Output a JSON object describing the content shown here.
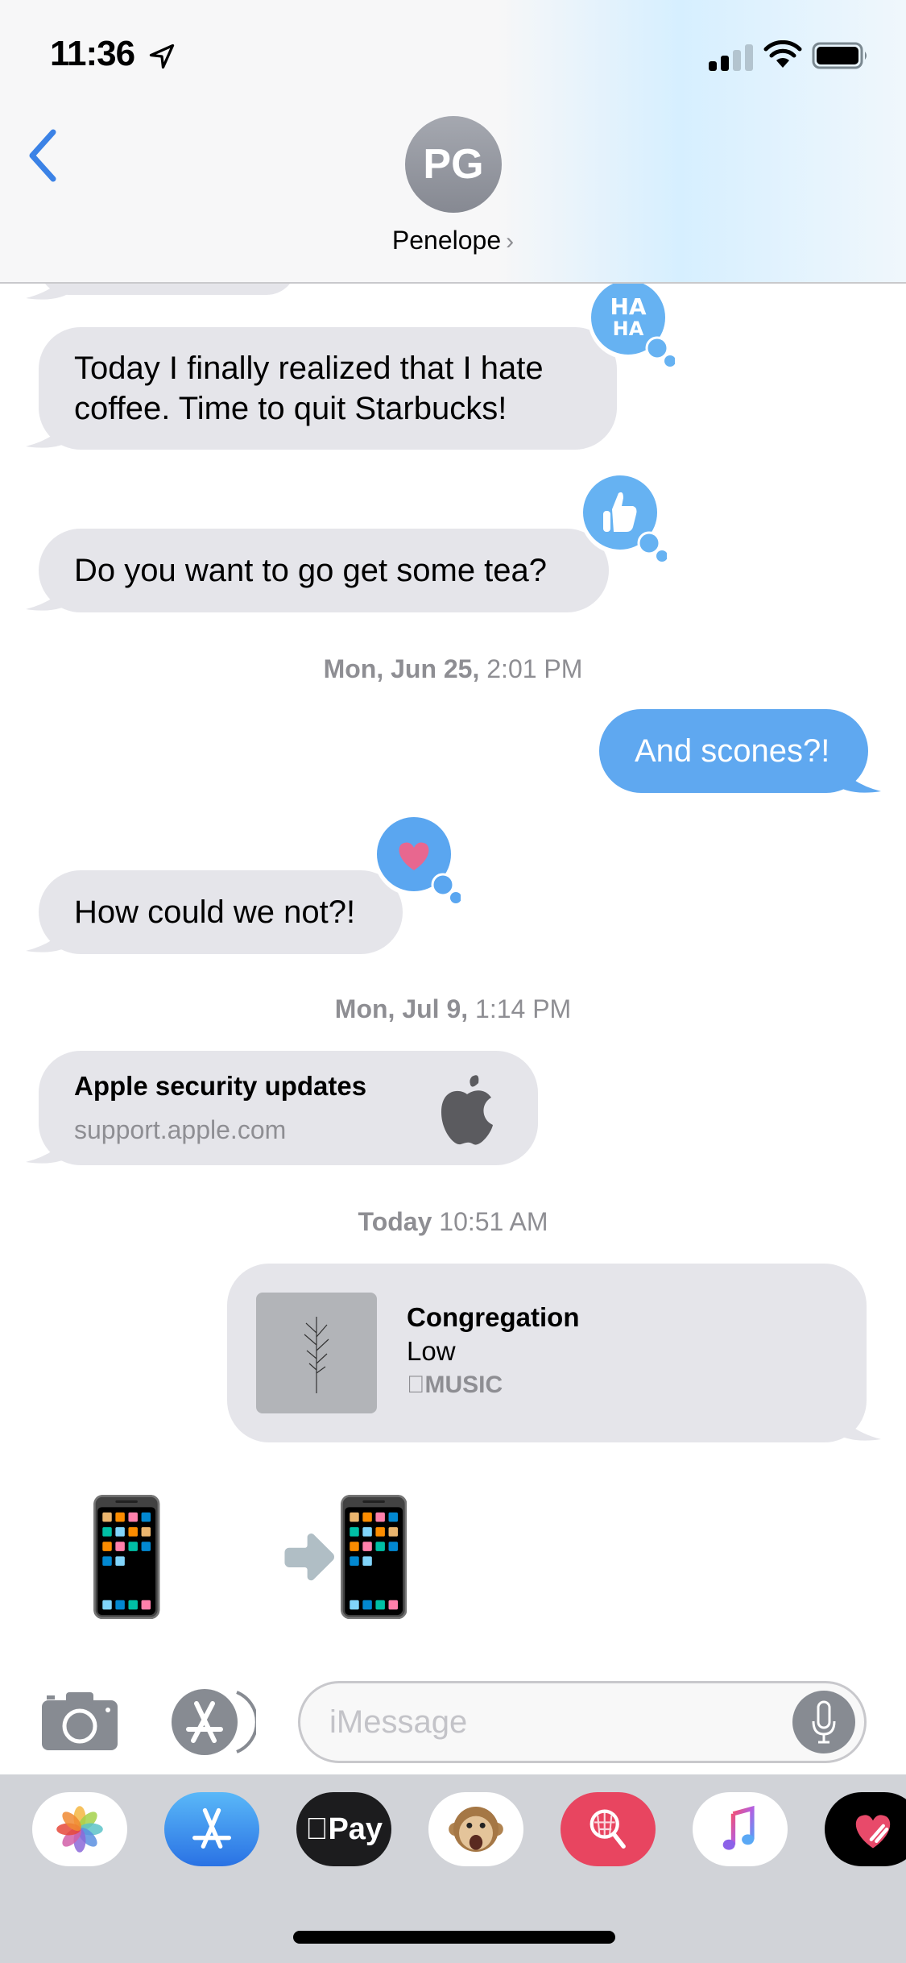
{
  "status_bar": {
    "time": "11:36",
    "location_icon": "location-arrow-icon",
    "signal_bars_filled": 2,
    "signal_bars_total": 4,
    "wifi_icon": "wifi-icon",
    "battery_level": 1.0
  },
  "header": {
    "back_icon": "chevron-left-icon",
    "avatar_initials": "PG",
    "contact_name": "Penelope",
    "contact_chevron": "›"
  },
  "colors": {
    "incoming_bubble": "#e5e5ea",
    "outgoing_bubble": "#5fa8f0",
    "tapback": "#66b2f2",
    "accent_blue": "#3b82e6",
    "timestamp_gray": "#8e8e93"
  },
  "messages": [
    {
      "type": "incoming",
      "text_lines": [
        "Today I finally realized that I hate",
        "coffee. Time to quit Starbucks!"
      ],
      "tapback": "haha",
      "tapback_text": [
        "HA",
        "HA"
      ]
    },
    {
      "type": "incoming",
      "text": "Do you want to go get some tea?",
      "tapback": "thumbs-up"
    },
    {
      "type": "timestamp",
      "bold": "Mon, Jun 25,",
      "rest": " 2:01 PM"
    },
    {
      "type": "outgoing",
      "text": "And scones?!"
    },
    {
      "type": "incoming",
      "text": "How could we not?!",
      "tapback": "heart"
    },
    {
      "type": "timestamp",
      "bold": "Mon, Jul 9,",
      "rest": " 1:14 PM"
    },
    {
      "type": "link",
      "title": "Apple security updates",
      "url": "support.apple.com",
      "icon": "apple-logo-icon"
    },
    {
      "type": "timestamp",
      "bold": "Today",
      "rest": " 10:51 AM"
    },
    {
      "type": "music",
      "title": "Congregation",
      "artist": "Low",
      "source": "MUSIC"
    },
    {
      "type": "emoji",
      "text": "📱 📲"
    }
  ],
  "composer": {
    "camera_icon": "camera-icon",
    "apps_icon": "app-store-icon",
    "placeholder": "iMessage",
    "mic_icon": "microphone-icon"
  },
  "app_drawer": [
    {
      "name": "Photos",
      "icon": "photos-icon"
    },
    {
      "name": "App Store",
      "icon": "app-store-icon"
    },
    {
      "name": "Apple Pay",
      "icon": "apple-pay-icon",
      "label": "Pay"
    },
    {
      "name": "Animoji",
      "icon": "monkey-animoji-icon"
    },
    {
      "name": "Images Search",
      "icon": "web-image-search-icon"
    },
    {
      "name": "Music",
      "icon": "music-note-icon"
    },
    {
      "name": "Digital Touch",
      "icon": "digital-touch-heart-icon"
    }
  ]
}
